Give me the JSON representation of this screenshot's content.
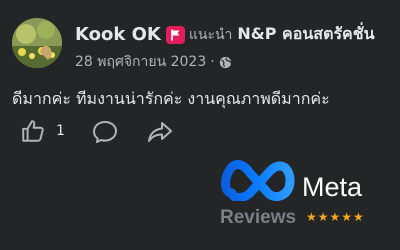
{
  "post": {
    "author_name": "Kook OK",
    "badge_icon": "recommend-flag-icon",
    "recommends_label": "แนะนำ",
    "page_name": "N&P คอนสตรัคชั่น",
    "date": "28 พฤศจิกายน 2023",
    "separator": "·",
    "privacy_icon": "globe-icon",
    "body": "ดีมากค่ะ ทีมงานน่ารักค่ะ งานคุณภาพดีมากค่ะ"
  },
  "actions": {
    "like_icon": "thumbs-up-icon",
    "like_count": "1",
    "comment_icon": "comment-icon",
    "share_icon": "share-icon"
  },
  "watermark": {
    "brand": "Meta",
    "subtitle": "Reviews",
    "stars": "★★★★★",
    "logo_icon": "meta-infinity-logo"
  },
  "colors": {
    "background": "#242526",
    "text_primary": "#e4e6eb",
    "text_secondary": "#b0b3b8",
    "badge": "#e41e5a",
    "meta_blue": "#0a7cff",
    "star": "#f5a623"
  }
}
